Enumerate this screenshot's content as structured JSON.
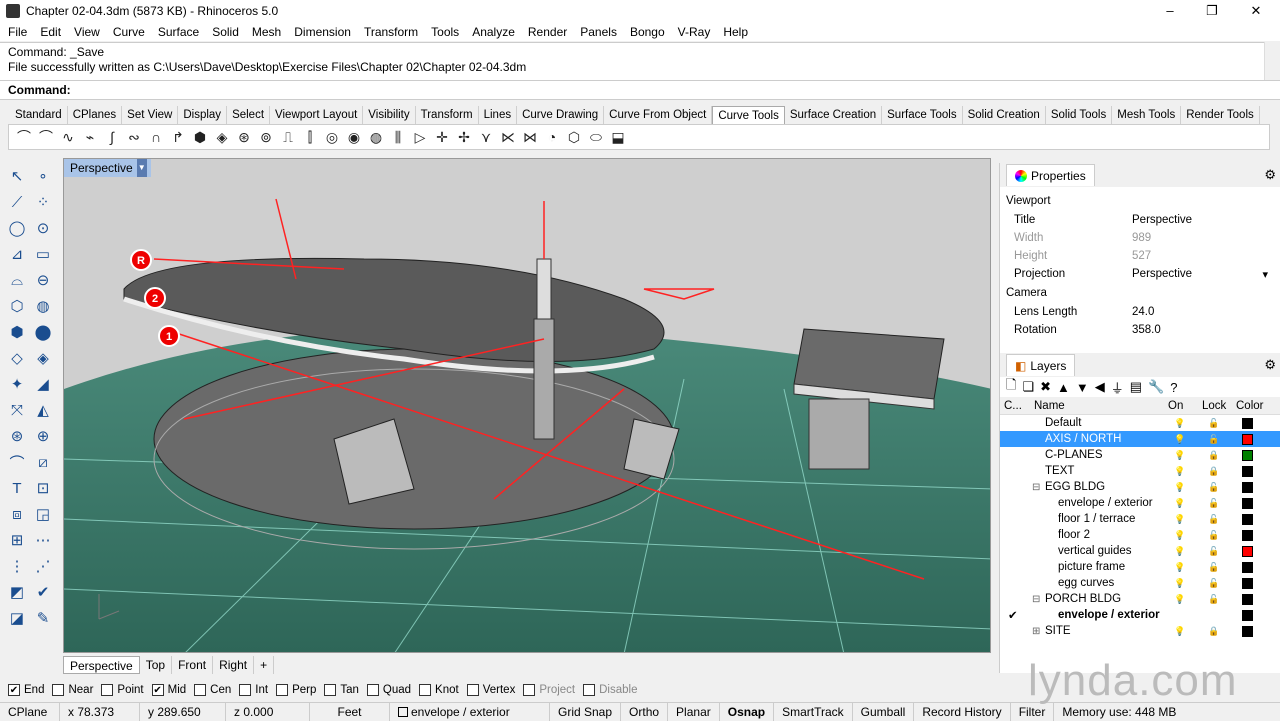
{
  "window": {
    "title": "Chapter 02-04.3dm (5873 KB) - Rhinoceros 5.0",
    "minimize": "–",
    "maximize": "❐",
    "close": "✕"
  },
  "menu": [
    "File",
    "Edit",
    "View",
    "Curve",
    "Surface",
    "Solid",
    "Mesh",
    "Dimension",
    "Transform",
    "Tools",
    "Analyze",
    "Render",
    "Panels",
    "Bongo",
    "V-Ray",
    "Help"
  ],
  "command": {
    "history_1": "Command: _Save",
    "history_2": "File successfully written as C:\\Users\\Dave\\Desktop\\Exercise Files\\Chapter 02\\Chapter 02-04.3dm",
    "prompt": "Command:"
  },
  "tabs": [
    "Standard",
    "CPlanes",
    "Set View",
    "Display",
    "Select",
    "Viewport Layout",
    "Visibility",
    "Transform",
    "Lines",
    "Curve Drawing",
    "Curve From Object",
    "Curve Tools",
    "Surface Creation",
    "Surface Tools",
    "Solid Creation",
    "Solid Tools",
    "Mesh Tools",
    "Render Tools"
  ],
  "active_tab": "Curve Tools",
  "viewport": {
    "label": "Perspective",
    "markers": [
      "R",
      "2",
      "1"
    ]
  },
  "viewport_tabs": [
    "Perspective",
    "Top",
    "Front",
    "Right"
  ],
  "properties": {
    "panel_title": "Properties",
    "section_viewport": "Viewport",
    "rows": [
      {
        "k": "Title",
        "v": "Perspective",
        "dis": false
      },
      {
        "k": "Width",
        "v": "989",
        "dis": true
      },
      {
        "k": "Height",
        "v": "527",
        "dis": true
      },
      {
        "k": "Projection",
        "v": "Perspective",
        "dis": false
      }
    ],
    "section_camera": "Camera",
    "camera_rows": [
      {
        "k": "Lens Length",
        "v": "24.0"
      },
      {
        "k": "Rotation",
        "v": "358.0"
      }
    ]
  },
  "layers": {
    "panel_title": "Layers",
    "col_c": "C...",
    "col_name": "Name",
    "col_on": "On",
    "col_lock": "Lock",
    "col_color": "Color",
    "rows": [
      {
        "name": "Default",
        "indent": 0,
        "color": "#000000",
        "sel": false,
        "lock": "open"
      },
      {
        "name": "AXIS / NORTH",
        "indent": 0,
        "color": "#ff0000",
        "sel": true,
        "lock": "open"
      },
      {
        "name": "C-PLANES",
        "indent": 0,
        "color": "#008000",
        "sel": false,
        "lock": "closed"
      },
      {
        "name": "TEXT",
        "indent": 0,
        "color": "#000000",
        "sel": false,
        "lock": "closed"
      },
      {
        "name": "EGG BLDG",
        "indent": 0,
        "color": "#000000",
        "sel": false,
        "lock": "open",
        "exp": "⊟"
      },
      {
        "name": "envelope / exterior",
        "indent": 1,
        "color": "#000000",
        "sel": false,
        "lock": "open"
      },
      {
        "name": "floor 1 / terrace",
        "indent": 1,
        "color": "#000000",
        "sel": false,
        "lock": "open"
      },
      {
        "name": "floor 2",
        "indent": 1,
        "color": "#000000",
        "sel": false,
        "lock": "open"
      },
      {
        "name": "vertical guides",
        "indent": 1,
        "color": "#ff0000",
        "sel": false,
        "lock": "open"
      },
      {
        "name": "picture frame",
        "indent": 1,
        "color": "#000000",
        "sel": false,
        "lock": "open"
      },
      {
        "name": "egg curves",
        "indent": 1,
        "color": "#000000",
        "sel": false,
        "lock": "open"
      },
      {
        "name": "PORCH BLDG",
        "indent": 0,
        "color": "#000000",
        "sel": false,
        "lock": "open",
        "exp": "⊟"
      },
      {
        "name": "envelope / exterior",
        "indent": 1,
        "color": "#000000",
        "sel": false,
        "lock": "none",
        "current": true
      },
      {
        "name": "SITE",
        "indent": 0,
        "color": "#000000",
        "sel": false,
        "lock": "closed",
        "exp": "⊞"
      }
    ]
  },
  "osnap": [
    {
      "label": "End",
      "checked": true
    },
    {
      "label": "Near",
      "checked": false
    },
    {
      "label": "Point",
      "checked": false
    },
    {
      "label": "Mid",
      "checked": true
    },
    {
      "label": "Cen",
      "checked": false
    },
    {
      "label": "Int",
      "checked": false
    },
    {
      "label": "Perp",
      "checked": false
    },
    {
      "label": "Tan",
      "checked": false
    },
    {
      "label": "Quad",
      "checked": false
    },
    {
      "label": "Knot",
      "checked": false
    },
    {
      "label": "Vertex",
      "checked": false
    },
    {
      "label": "Project",
      "checked": false,
      "disabled": true
    },
    {
      "label": "Disable",
      "checked": false,
      "disabled": true
    }
  ],
  "status": {
    "cplane": "CPlane",
    "x": "x 78.373",
    "y": "y 289.650",
    "z": "z 0.000",
    "units": "Feet",
    "layer": "envelope / exterior",
    "grid_snap": "Grid Snap",
    "ortho": "Ortho",
    "planar": "Planar",
    "osnap": "Osnap",
    "smarttrack": "SmartTrack",
    "gumball": "Gumball",
    "record_history": "Record History",
    "filter": "Filter",
    "memory": "Memory use: 448 MB"
  },
  "watermark": "lynda.com"
}
